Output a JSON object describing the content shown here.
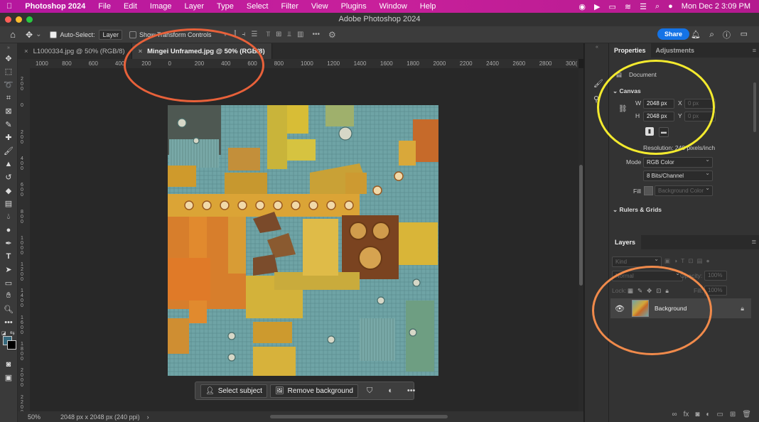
{
  "menubar": {
    "apple_icon": "apple-icon",
    "app_name": "Photoshop 2024",
    "items": [
      "File",
      "Edit",
      "Image",
      "Layer",
      "Type",
      "Select",
      "Filter",
      "View",
      "Plugins",
      "Window",
      "Help"
    ],
    "datetime": "Mon Dec 2  3:09 PM"
  },
  "window": {
    "title": "Adobe Photoshop 2024"
  },
  "options_bar": {
    "auto_select_label": "Auto-Select:",
    "auto_select_value": "Layer",
    "show_transform_label": "Show Transform Controls",
    "share_label": "Share"
  },
  "tabs": [
    {
      "label": "L1000334.jpg @ 50% (RGB/8)",
      "active": false
    },
    {
      "label": "Mingei Unframed.jpg @ 50% (RGB/8)",
      "active": true
    }
  ],
  "rulers": {
    "horizontal": [
      "1000",
      "800",
      "600",
      "400",
      "200",
      "0",
      "200",
      "400",
      "600",
      "800",
      "1000",
      "1200",
      "1400",
      "1600",
      "1800",
      "2000",
      "2200",
      "2400",
      "2600",
      "2800",
      "300("
    ],
    "vertical": [
      "2\n0\n0",
      "0",
      "2\n0\n0",
      "4\n0\n0",
      "6\n0\n0",
      "8\n0\n0",
      "1\n0\n0\n0",
      "1\n2\n0\n0",
      "1\n4\n0\n0",
      "1\n6\n0\n0",
      "1\n8\n0\n0",
      "2\n0\n0\n0",
      "2\n2\n0\n0"
    ]
  },
  "context_bar": {
    "select_subject": "Select subject",
    "remove_background": "Remove background"
  },
  "status": {
    "zoom": "50%",
    "doc_info": "2048 px x 2048 px (240 ppi)"
  },
  "properties": {
    "tab_properties": "Properties",
    "tab_adjustments": "Adjustments",
    "document_label": "Document",
    "canvas_header": "Canvas",
    "w_label": "W",
    "w_value": "2048 px",
    "h_label": "H",
    "h_value": "2048 px",
    "x_label": "X",
    "x_placeholder": "0 px",
    "y_label": "Y",
    "y_placeholder": "0 px",
    "resolution": "Resolution: 240 pixels/inch",
    "mode_label": "Mode",
    "mode_value": "RGB Color",
    "bits_value": "8 Bits/Channel",
    "fill_label": "Fill",
    "fill_value": "Background Color",
    "rulers_header": "Rulers & Grids"
  },
  "layers": {
    "tab": "Layers",
    "kind_placeholder": "Kind",
    "blend_mode": "Normal",
    "opacity_label": "Opacity:",
    "opacity_value": "100%",
    "lock_label": "Lock:",
    "fill_label": "Fill:",
    "fill_value": "100%",
    "layer_name": "Background"
  },
  "annotations": {
    "colors": {
      "orange": "#e8613a",
      "yellow": "#f3ea2e",
      "light_orange": "#f08a4b"
    }
  }
}
